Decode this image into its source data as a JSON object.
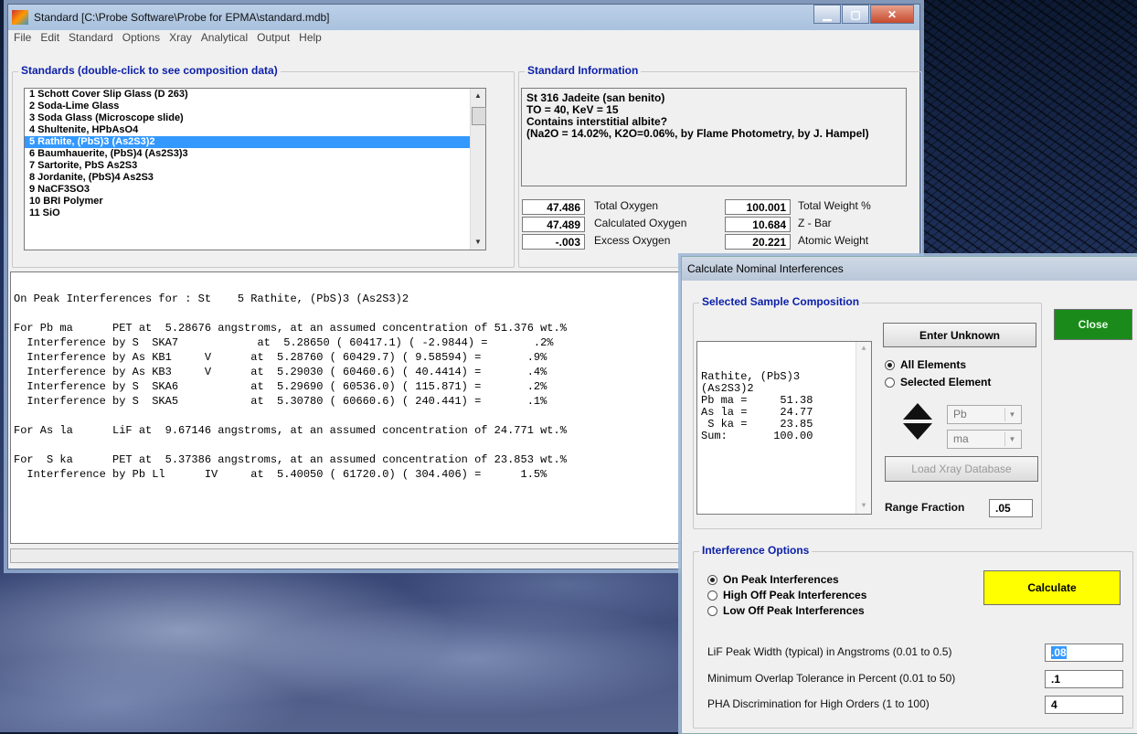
{
  "main": {
    "title": "Standard [C:\\Probe Software\\Probe for EPMA\\standard.mdb]",
    "menu": [
      "File",
      "Edit",
      "Standard",
      "Options",
      "Xray",
      "Analytical",
      "Output",
      "Help"
    ],
    "standards_group": "Standards (double-click to see composition data)",
    "standards": [
      "1 Schott Cover Slip Glass (D 263)",
      "2 Soda-Lime Glass",
      "3 Soda Glass (Microscope slide)",
      "4 Shultenite, HPbAsO4",
      "5 Rathite, (PbS)3 (As2S3)2",
      "6 Baumhauerite, (PbS)4 (As2S3)3",
      "7 Sartorite, PbS As2S3",
      "8 Jordanite, (PbS)4 As2S3",
      "9 NaCF3SO3",
      "10 BRI Polymer",
      "11 SiO"
    ],
    "selected_index": 4,
    "info_group": "Standard Information",
    "info_text": "St 316 Jadeite (san benito)\nTO = 40, KeV = 15\nContains interstitial albite?\n(Na2O = 14.02%, K2O=0.06%, by Flame Photometry, by J. Hampel)",
    "stats": {
      "total_oxygen": "47.486",
      "total_oxygen_label": "Total Oxygen",
      "calc_oxygen": "47.489",
      "calc_oxygen_label": "Calculated Oxygen",
      "excess_oxygen": "-.003",
      "excess_oxygen_label": "Excess Oxygen",
      "total_weight": "100.001",
      "total_weight_label": "Total Weight %",
      "zbar": "10.684",
      "zbar_label": "Z - Bar",
      "atomic_weight": "20.221",
      "atomic_weight_label": "Atomic Weight"
    },
    "output_lines": [
      "On Peak Interferences for : St    5 Rathite, (PbS)3 (As2S3)2",
      "",
      "For Pb ma      PET at  5.28676 angstroms, at an assumed concentration of 51.376 wt.%",
      "  Interference by S  SKA7            at  5.28650 ( 60417.1) ( -2.9844) =       .2%",
      "  Interference by As KB1     V      at  5.28760 ( 60429.7) ( 9.58594) =       .9%",
      "  Interference by As KB3     V      at  5.29030 ( 60460.6) ( 40.4414) =       .4%",
      "  Interference by S  SKA6           at  5.29690 ( 60536.0) ( 115.871) =       .2%",
      "  Interference by S  SKA5           at  5.30780 ( 60660.6) ( 240.441) =       .1%",
      "",
      "For As la      LiF at  9.67146 angstroms, at an assumed concentration of 24.771 wt.%",
      "",
      "For  S ka      PET at  5.37386 angstroms, at an assumed concentration of 23.853 wt.%",
      "  Interference by Pb Ll      IV     at  5.40050 ( 61720.0) ( 304.406) =      1.5%"
    ]
  },
  "dialog": {
    "title": "Calculate Nominal Interferences",
    "composition_group": "Selected Sample Composition",
    "composition_text": "Rathite, (PbS)3\n(As2S3)2\nPb ma =     51.38\nAs la =     24.77\n S ka =     23.85\nSum:       100.00",
    "enter_unknown": "Enter Unknown",
    "close": "Close",
    "all_elements": "All Elements",
    "selected_element": "Selected Element",
    "element": "Pb",
    "xray_line": "ma",
    "load_xray_db": "Load Xray Database",
    "range_fraction_label": "Range Fraction",
    "range_fraction": ".05",
    "interference_group": "Interference Options",
    "on_peak": "On Peak Interferences",
    "high_off_peak": "High Off Peak Interferences",
    "low_off_peak": "Low Off Peak Interferences",
    "calculate": "Calculate",
    "lif_label": "LiF Peak Width (typical) in Angstroms (0.01 to 0.5)",
    "lif_value": ".08",
    "overlap_label": "Minimum Overlap Tolerance in Percent (0.01 to 50)",
    "overlap_value": ".1",
    "pha_label": "PHA Discrimination for High Orders (1 to 100)",
    "pha_value": "4"
  },
  "colors": {
    "close_button": "#1a8a1a",
    "calculate_button": "#ffff00",
    "group_title": "#0b1fa8",
    "selection": "#3399ff"
  }
}
